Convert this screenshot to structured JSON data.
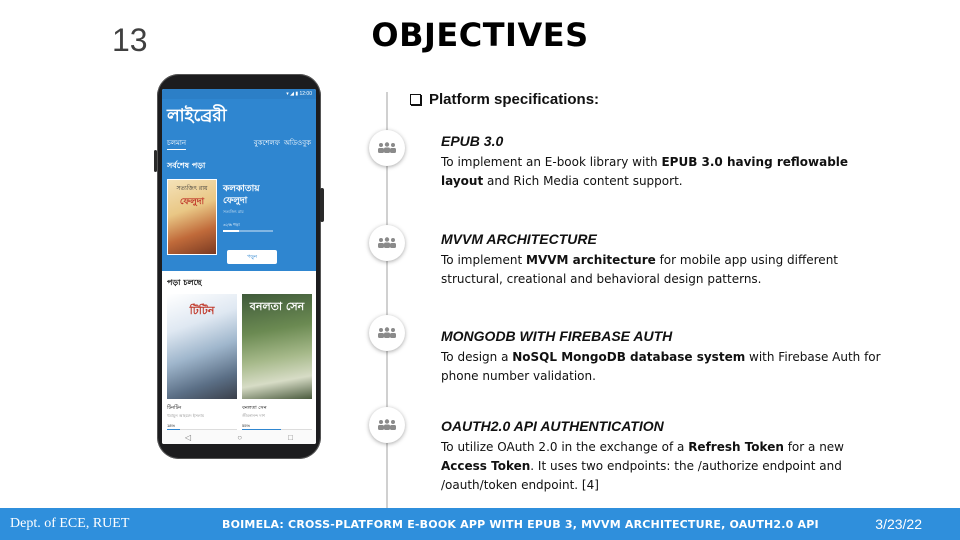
{
  "slide": {
    "number": "13",
    "title": "OBJECTIVES"
  },
  "phone": {
    "status_time": "▾ ◢ ▮ 12:00",
    "app_title": "লাইব্রেরী",
    "tabs": {
      "current": "চলমান",
      "bookshelf": "বুকশেলফ",
      "audiobook": "অডিওবুক"
    },
    "recent_heading": "সর্বশেষ পড়া",
    "recent_book": {
      "cover_top": "সত্যজিৎ রায়",
      "cover_title": "ফেলুদা",
      "title_line1": "কলকাতায়",
      "title_line2": "ফেলুদা",
      "author": "সত্যজিৎ রায়",
      "progress_label": "৩২% পড়া",
      "progress": 0.32,
      "read_button": "পড়ুন"
    },
    "reading_heading": "পড়া চলছে",
    "books": [
      {
        "cover_title": "টিটিন",
        "name": "টিনটিন",
        "author": "হুমায়ুন আহমেদ ইসলাম",
        "pct_label": "18%",
        "progress": 0.18
      },
      {
        "cover_title": "বনলতা সেন",
        "name": "বনলতা সেন",
        "author": "জীবনানন্দ দাশ",
        "pct_label": "55%",
        "progress": 0.55
      }
    ],
    "nav": {
      "back": "◁",
      "home": "○",
      "recent": "□"
    }
  },
  "specs": {
    "heading": "Platform specifications:",
    "items": [
      {
        "title": "EPUB 3.0",
        "desc_parts": [
          "To implement an E-book library with ",
          "EPUB 3.0 having reflowable layout",
          " and Rich Media content support."
        ]
      },
      {
        "title": "MVVM ARCHITECTURE",
        "desc_parts": [
          "To implement ",
          "MVVM architecture",
          " for mobile app using different structural, creational and behavioral design patterns."
        ]
      },
      {
        "title": "MONGODB WITH FIREBASE AUTH",
        "desc_parts": [
          "To design a ",
          "NoSQL MongoDB database system",
          " with Firebase Auth for phone number validation."
        ]
      },
      {
        "title": "OAUTH2.0 API AUTHENTICATION",
        "desc_parts": [
          "To utilize OAuth 2.0 in the exchange of a ",
          "Refresh Token",
          " for a new ",
          "Access Token",
          ". It uses two endpoints: the /authorize endpoint and /oauth/token endpoint.  [4]"
        ]
      }
    ]
  },
  "footer": {
    "left": "Dept. of ECE, RUET",
    "center": "BOIMELA: CROSS-PLATFORM E-BOOK APP WITH EPUB 3, MVVM ARCHITECTURE, OAUTH2.0 API",
    "right": "3/23/22"
  },
  "colors": {
    "accent": "#2f8fdc",
    "app_blue": "#2f86d0"
  },
  "icons": [
    "team-icon"
  ]
}
